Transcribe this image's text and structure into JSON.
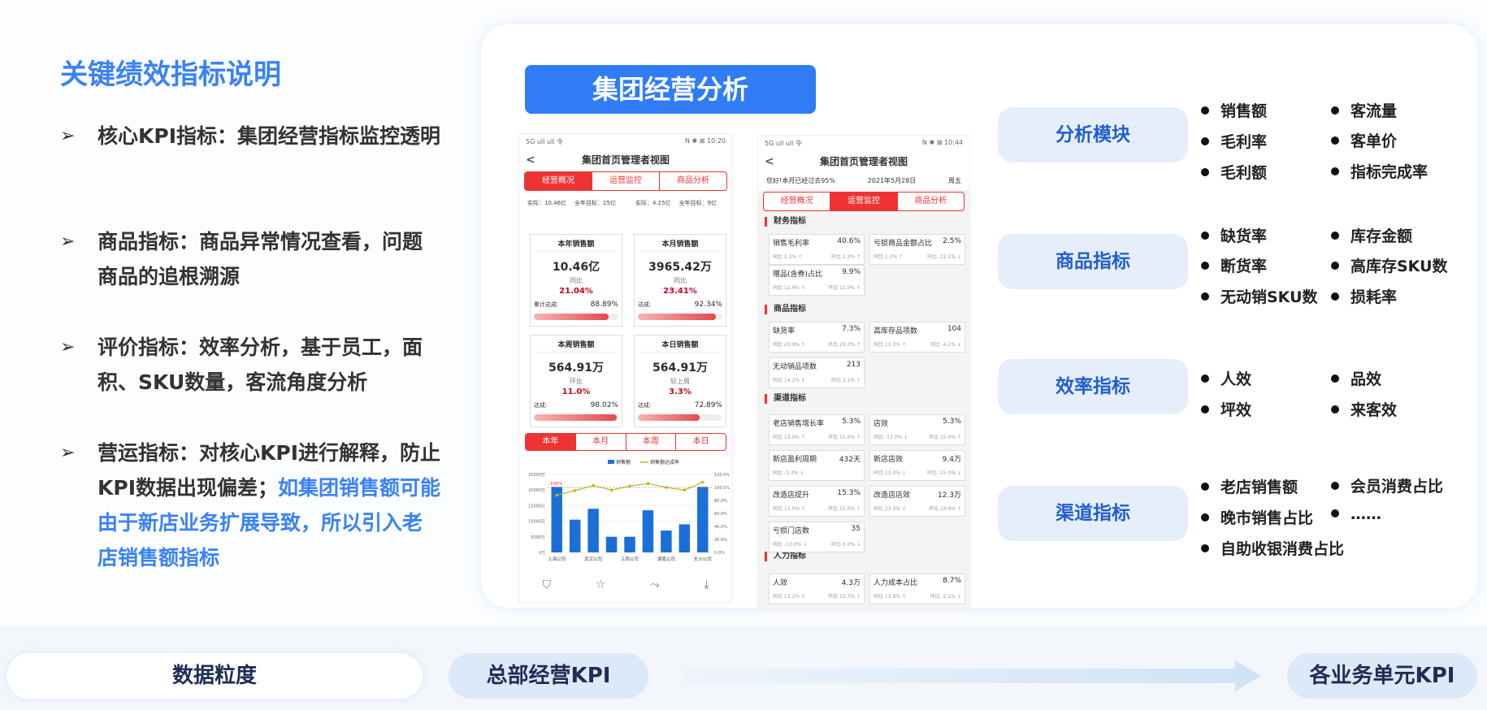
{
  "left": {
    "title": "关键绩效指标说明",
    "bullets": [
      {
        "head": "核心KPI指标：集团经营指标监控透明",
        "tail": ""
      },
      {
        "head": "商品指标：商品异常情况查看，问题商品的追根溯源",
        "tail": ""
      },
      {
        "head": "评价指标：效率分析，基于员工，面积、SKU数量，客流角度分析",
        "tail": ""
      },
      {
        "head": "营运指标：对核心KPI进行解释，防止KPI数据出现偏差；",
        "tail": "如集团销售额可能由于新店业务扩展导致，所以引入老店销售额指标"
      }
    ]
  },
  "panel": {
    "title": "集团经营分析"
  },
  "phone1": {
    "status_left": "5G ull ull 令",
    "status_right": "N ✱ ⊠ 10:20",
    "title": "集团首页管理者视图",
    "tabs": [
      "经营概况",
      "运营监控",
      "商品分析"
    ],
    "info": [
      "实际：",
      "10.46亿",
      "全年目标：",
      "25亿",
      "实际：",
      "4.25亿",
      "全年目标：",
      "9亿"
    ],
    "cards": [
      {
        "h": "本年销售额",
        "v": "10.46亿",
        "s": "同比",
        "p": "21.04%",
        "rl": "累计达成:",
        "rv": "88.89%",
        "fill": 0.8889
      },
      {
        "h": "本月销售额",
        "v": "3965.42万",
        "s": "同比",
        "p": "23.41%",
        "rl": "达成:",
        "rv": "92.34%",
        "fill": 0.9234
      },
      {
        "h": "本周销售额",
        "v": "564.91万",
        "s": "环比",
        "p": "11.0%",
        "rl": "达成:",
        "rv": "98.02%",
        "fill": 0.9802
      },
      {
        "h": "本日销售额",
        "v": "564.91万",
        "s": "较上周",
        "p": "3.3%",
        "rl": "达成:",
        "rv": "72.89%",
        "fill": 0.7289
      }
    ],
    "time_tabs": [
      "本年",
      "本月",
      "本周",
      "本日"
    ],
    "icons": [
      "filter-icon",
      "star-icon",
      "share-icon",
      "download-icon"
    ]
  },
  "chart_data": {
    "type": "bar",
    "categories": [
      "上海公司",
      "武汉公司",
      "江西公司",
      "湖南公司",
      "长沙公司"
    ],
    "series": [
      {
        "name": "销售额",
        "values": [
          21000,
          10500,
          14000,
          5000,
          5000,
          13500,
          7000,
          9000,
          21000
        ]
      },
      {
        "name": "销售额达成率",
        "values": [
          88,
          95,
          103,
          96,
          102,
          106,
          100,
          96,
          108
        ]
      }
    ],
    "bar_labels": [
      "上海公司",
      "",
      "武汉公司",
      "",
      "江西公司",
      "",
      "湖南公司",
      "",
      "长沙公司"
    ],
    "ylim": [
      0,
      25000
    ],
    "y2lim": [
      0,
      120
    ],
    "yticks": [
      "25000万",
      "20000万",
      "15000万",
      "10000万",
      "5000万",
      "0万"
    ],
    "y2ticks": [
      "120.0%",
      "100.0%",
      "80.0%",
      "60.0%",
      "40.0%",
      "20.0%",
      "0.0%"
    ],
    "annotation": "100%",
    "colors": {
      "bar": "#1b6fd6",
      "line": "#9bc53d"
    }
  },
  "phone2": {
    "status_left": "5G ull ull 令",
    "status_right": "N ✱ ⊠ 10:44",
    "title": "集团首页管理者视图",
    "greet": "您好!本月已经过去95%",
    "date": "2021年5月28日",
    "weekday": "周五",
    "tabs": [
      "经营概况",
      "运营监控",
      "商品分析"
    ],
    "sections": [
      {
        "name": "财务指标",
        "metrics": [
          {
            "n": "销售毛利率",
            "v": "40.6%",
            "a": "同比 2.3% ↑",
            "b": "环比 1.3% ↑"
          },
          {
            "n": "亏损商品金额占比",
            "v": "2.5%",
            "a": "同比 1.3% ↑",
            "b": "环比 -12.1% ↓"
          },
          {
            "n": "赠品(含券)占比",
            "v": "9.9%",
            "a": "同比 12.4% ↑",
            "b": "环比 11.0% ↑"
          }
        ]
      },
      {
        "name": "商品指标",
        "metrics": [
          {
            "n": "缺货率",
            "v": "7.3%",
            "a": "同比 23.9% ↑",
            "b": "环比 29.3% ↑"
          },
          {
            "n": "高库存品项数",
            "v": "104",
            "a": "同比 13.3% ↑",
            "b": "环比 -4.2% ↓"
          },
          {
            "n": "无动销品项数",
            "v": "213",
            "a": "同比 14.2% ↑",
            "b": "环比 3.1% ↑"
          }
        ]
      },
      {
        "name": "渠道指标",
        "metrics": [
          {
            "n": "老店销售增长率",
            "v": "5.3%",
            "a": "同比 13.0% ↑",
            "b": "环比 15.0% ↑"
          },
          {
            "n": "店效",
            "v": "5.3%",
            "a": "同比 -13.0% ↓",
            "b": "环比 15.0% ↑"
          },
          {
            "n": "新店盈利周期",
            "v": "432天",
            "a": "同比 -3.3% ↓",
            "b": ""
          },
          {
            "n": "新店店效",
            "v": "9.4万",
            "a": "同比 13.0% ↓",
            "b": "环比 -15.0% ↓"
          },
          {
            "n": "改造店提升",
            "v": "15.3%",
            "a": "同比 13.0% ↑",
            "b": "环比 15.0% ↑"
          },
          {
            "n": "改造店店效",
            "v": "12.3万",
            "a": "同比 23.3% ↓",
            "b": "环比 24.9% ↑"
          },
          {
            "n": "亏损门店数",
            "v": "35",
            "a": "同比 -13.0% ↓",
            "b": "环比 0.0% ↓"
          }
        ]
      },
      {
        "name": "人力指标",
        "metrics": [
          {
            "n": "人效",
            "v": "4.3万",
            "a": "同比 13.2% ↑",
            "b": "环比 15.3% ↑"
          },
          {
            "n": "人力成本占比",
            "v": "8.7%",
            "a": "同比 13.0% ↑",
            "b": "环比 -2.1% ↓"
          }
        ]
      }
    ]
  },
  "modules": [
    {
      "label": "分析模块",
      "col1": [
        "销售额",
        "毛利率",
        "毛利额"
      ],
      "col2": [
        "客流量",
        "客单价",
        "指标完成率"
      ]
    },
    {
      "label": "商品指标",
      "col1": [
        "缺货率",
        "断货率",
        "无动销SKU数"
      ],
      "col2": [
        "库存金额",
        "高库存SKU数",
        "损耗率"
      ]
    },
    {
      "label": "效率指标",
      "col1": [
        "人效",
        "坪效"
      ],
      "col2": [
        "品效",
        "来客效"
      ]
    },
    {
      "label": "渠道指标",
      "col1": [
        "老店销售额",
        "晚市销售占比",
        "自助收银消费占比"
      ],
      "col2": [
        "会员消费占比",
        "……"
      ]
    }
  ],
  "bottom": {
    "granularity": "数据粒度",
    "hq": "总部经营KPI",
    "units": "各业务单元KPI"
  }
}
